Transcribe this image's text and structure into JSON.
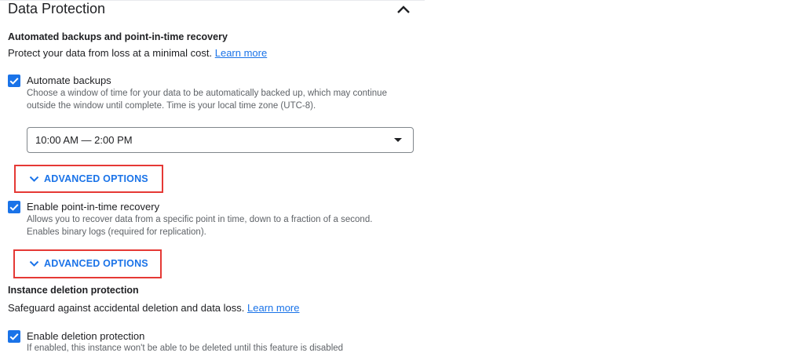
{
  "section": {
    "title": "Data Protection"
  },
  "backups": {
    "heading": "Automated backups and point-in-time recovery",
    "description": "Protect your data from loss at a minimal cost.",
    "learn_more": "Learn more",
    "automate": {
      "label": "Automate backups",
      "checked": true,
      "desc_line1": "Choose a window of time for your data to be automatically backed up, which may continue",
      "desc_line2": "outside the window until complete. Time is your local time zone (UTC-8)."
    },
    "window_select": {
      "value": "10:00 AM — 2:00 PM"
    },
    "advanced_1": "ADVANCED OPTIONS",
    "pitr": {
      "label": "Enable point-in-time recovery",
      "checked": true,
      "desc_line1": "Allows you to recover data from a specific point in time, down to a fraction of a second.",
      "desc_line2": "Enables binary logs (required for replication)."
    },
    "advanced_2": "ADVANCED OPTIONS"
  },
  "deletion": {
    "heading": "Instance deletion protection",
    "description": "Safeguard against accidental deletion and data loss.",
    "learn_more": "Learn more",
    "enable": {
      "label": "Enable deletion protection",
      "checked": true,
      "desc_line1": "If enabled, this instance won't be able to be deleted until this feature is disabled"
    }
  },
  "colors": {
    "accent": "#1a73e8",
    "highlight": "#e53935",
    "text": "#202124",
    "secondary": "#5f6368"
  },
  "icons": [
    "chevron-up-icon",
    "check-icon",
    "dropdown-arrow-icon",
    "chevron-down-icon"
  ]
}
